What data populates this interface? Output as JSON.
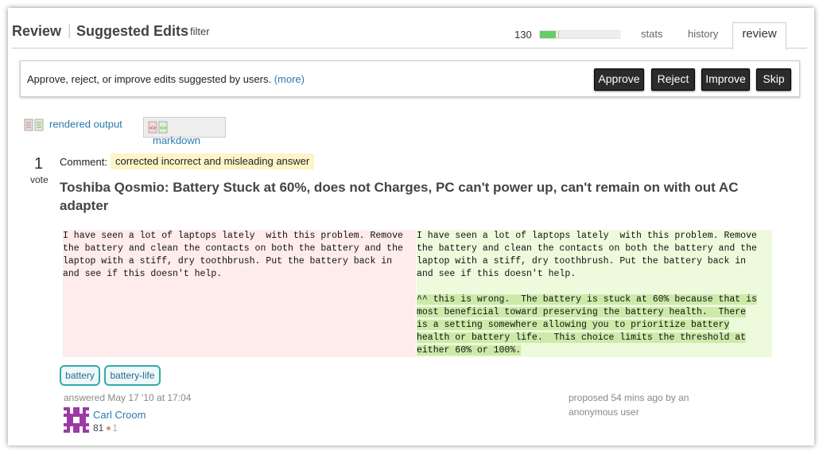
{
  "header": {
    "review": "Review",
    "separator": "|",
    "suggested_edits": "Suggested Edits",
    "filter": "filter",
    "count": "130",
    "progress_fraction": 0.2,
    "tabs": {
      "stats": "stats",
      "history": "history",
      "review": "review"
    }
  },
  "infobar": {
    "text": "Approve, reject, or improve edits suggested by users. ",
    "more": "(more)",
    "buttons": {
      "approve": "Approve",
      "reject": "Reject",
      "improve": "Improve",
      "skip": "Skip"
    }
  },
  "view_toggle": {
    "rendered": "rendered output",
    "markdown": "markdown"
  },
  "post": {
    "votes": "1",
    "vote_label": "vote",
    "comment_label": "Comment:",
    "comment": "corrected incorrect and misleading answer",
    "title": "Toshiba Qosmio: Battery Stuck at 60%, does not Charges, PC can't power up, can't remain on with out AC adapter",
    "original_text": "I have seen a lot of laptops lately  with this problem. Remove\nthe battery and clean the contacts on both the battery and the\nlaptop with a stiff, dry toothbrush. Put the battery back in\nand see if this doesn't help.",
    "edited_text": "I have seen a lot of laptops lately  with this problem. Remove\nthe battery and clean the contacts on both the battery and the\nlaptop with a stiff, dry toothbrush. Put the battery back in\nand see if this doesn't help.",
    "added_lines": [
      "^^ this is wrong.  The battery is stuck at 60% because that is",
      "most beneficial toward preserving the battery health.  There",
      "is a setting somewhere allowing you to prioritize battery",
      "health or battery life.  This choice limits the threshold at",
      "either 60% or 100%."
    ],
    "tags": [
      "battery",
      "battery-life"
    ],
    "answered": "answered May 17 '10 at 17:04",
    "user": {
      "name": "Carl Croom",
      "rep": "81",
      "bronze": "1"
    },
    "proposed_line1": "proposed 54 mins ago by an",
    "proposed_line2": "anonymous user"
  },
  "colors": {
    "link": "#2a7ab0",
    "removed_bg": "#fdecea",
    "added_bg": "#eefadc",
    "added_highlight": "#cdeaa9",
    "comment_bg": "#fdf5c8",
    "progress_fill": "#66cc66"
  }
}
